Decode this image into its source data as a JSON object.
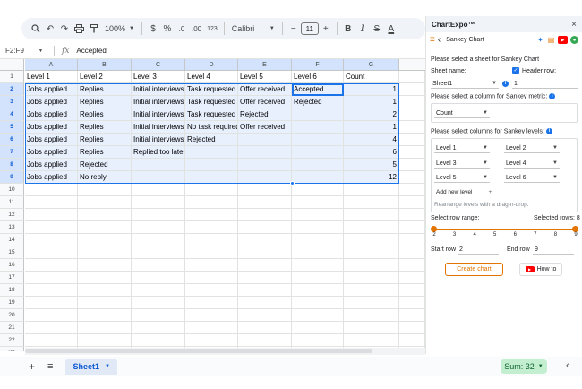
{
  "toolbar": {
    "zoom": "100%",
    "currency": "$",
    "percent": "%",
    "decrease_decimal": ".0",
    "increase_decimal": ".00",
    "number_format": "123",
    "font": "Calibri",
    "font_size": "11",
    "minus": "−",
    "plus": "+",
    "bold": "B",
    "italic": "I",
    "strike": "S",
    "text_color": "A"
  },
  "formula_bar": {
    "name_box": "F2:F9",
    "fx": "fx",
    "value": "Accepted"
  },
  "columns": [
    "A",
    "B",
    "C",
    "D",
    "E",
    "F",
    "G"
  ],
  "rows": [
    [
      "Level 1",
      "Level 2",
      "Level 3",
      "Level 4",
      "Level 5",
      "Level 6",
      "Count"
    ],
    [
      "Jobs applied",
      "Replies",
      "Initial interviews",
      "Task requested",
      "Offer received",
      "Accepted",
      "1"
    ],
    [
      "Jobs applied",
      "Replies",
      "Initial interviews",
      "Task requested",
      "Offer received",
      "Rejected",
      "1"
    ],
    [
      "Jobs applied",
      "Replies",
      "Initial interviews",
      "Task requested",
      "Rejected",
      "",
      "2"
    ],
    [
      "Jobs applied",
      "Replies",
      "Initial interviews",
      "No task required",
      "Offer received",
      "",
      "1"
    ],
    [
      "Jobs applied",
      "Replies",
      "Initial interviews",
      "Rejected",
      "",
      "",
      "4"
    ],
    [
      "Jobs applied",
      "Replies",
      "Replied too late",
      "",
      "",
      "",
      "6"
    ],
    [
      "Jobs applied",
      "Rejected",
      "",
      "",
      "",
      "",
      "5"
    ],
    [
      "Jobs applied",
      "No reply",
      "",
      "",
      "",
      "",
      "12"
    ]
  ],
  "row_numbers": [
    "1",
    "2",
    "3",
    "4",
    "5",
    "6",
    "7",
    "8",
    "9",
    "10",
    "11",
    "12",
    "13",
    "14",
    "15",
    "16",
    "17",
    "18",
    "19",
    "20",
    "21",
    "22",
    "23"
  ],
  "bottom": {
    "add": "+",
    "all_sheets": "≡",
    "sheet_name": "Sheet1",
    "sum": "Sum: 32"
  },
  "panel": {
    "title": "ChartExpo™",
    "close": "×",
    "nav_title": "Sankey Chart",
    "select_sheet_label": "Please select a sheet for Sankey Chart",
    "sheet_name_label": "Sheet name:",
    "sheet_value": "Sheet1",
    "header_row_label": "Header row:",
    "header_row_value": "1",
    "metric_label": "Please select a column for Sankey metric:",
    "metric_value": "Count",
    "levels_label": "Please select columns for Sankey levels:",
    "levels": [
      "Level 1",
      "Level 2",
      "Level 3",
      "Level 4",
      "Level 5",
      "Level 6"
    ],
    "add_level": "Add new level",
    "add_level_plus": "+",
    "rearrange_hint": "Rearrange levels with a drag-n-drop.",
    "row_range_label": "Select row range:",
    "selected_rows": "Selected rows: 8",
    "ticks": [
      "2",
      "3",
      "4",
      "5",
      "6",
      "7",
      "8",
      "9"
    ],
    "start_row_label": "Start row",
    "start_row_value": "2",
    "end_row_label": "End row",
    "end_row_value": "9",
    "create_chart": "Create chart",
    "how_to": "How to"
  },
  "colors": {
    "accent": "#e37400",
    "selection": "#1a73e8",
    "sum_bg": "#c4eed0"
  }
}
